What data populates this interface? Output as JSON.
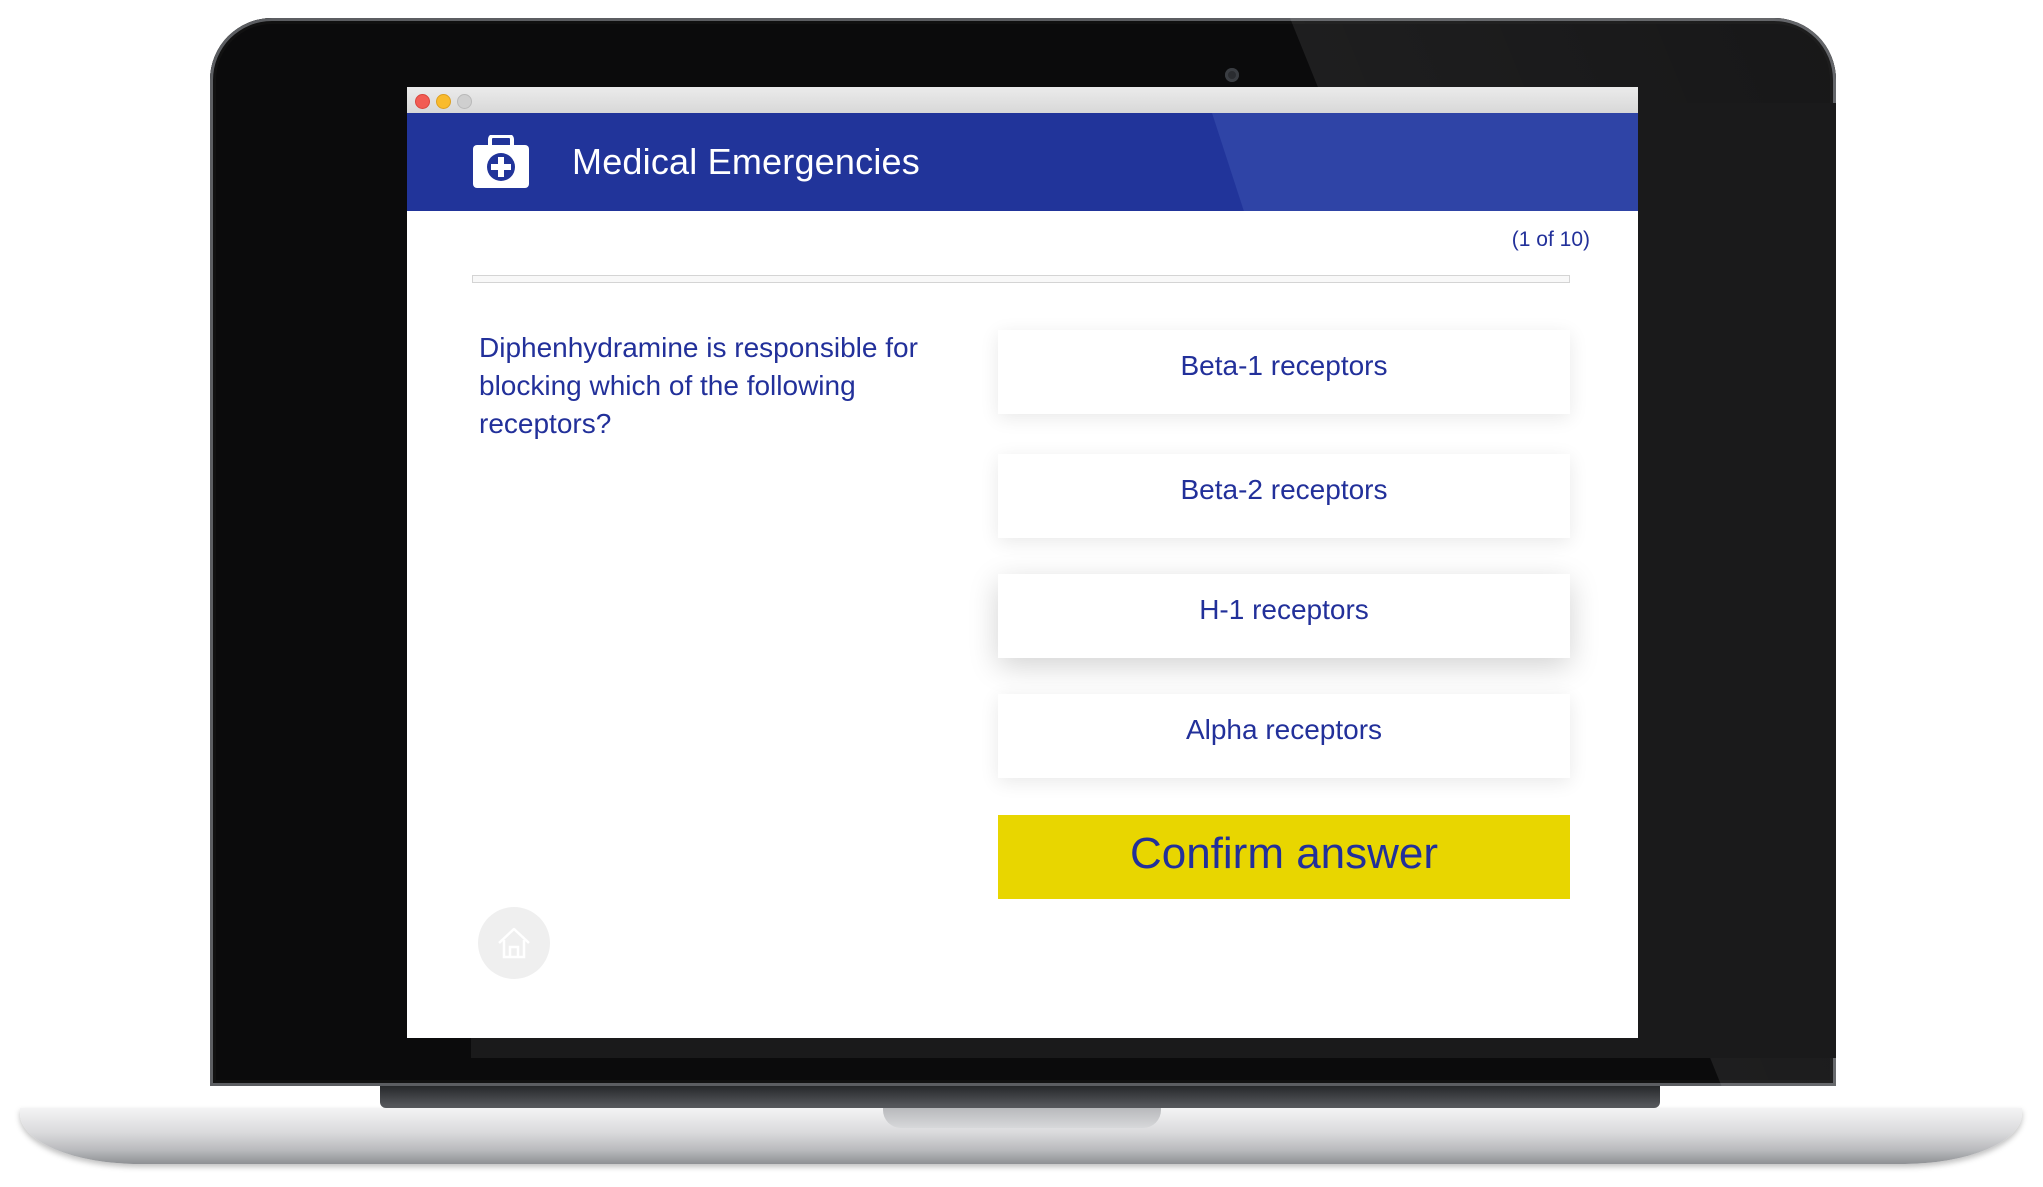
{
  "app": {
    "title": "Medical Emergencies",
    "icon": "first-aid-kit-icon",
    "colors": {
      "header_blue": "#21349a",
      "text_blue": "#22309a",
      "confirm_yellow": "#e8d600"
    }
  },
  "progress": {
    "label": "(1 of 10)",
    "current": 1,
    "total": 10
  },
  "question": {
    "text": "Diphenhydramine is responsible for blocking which of the following receptors?"
  },
  "answers": [
    {
      "label": "Beta-1 receptors"
    },
    {
      "label": "Beta-2 receptors"
    },
    {
      "label": "H-1 receptors"
    },
    {
      "label": "Alpha receptors"
    }
  ],
  "actions": {
    "confirm_label": "Confirm answer",
    "home_icon": "home-icon"
  }
}
